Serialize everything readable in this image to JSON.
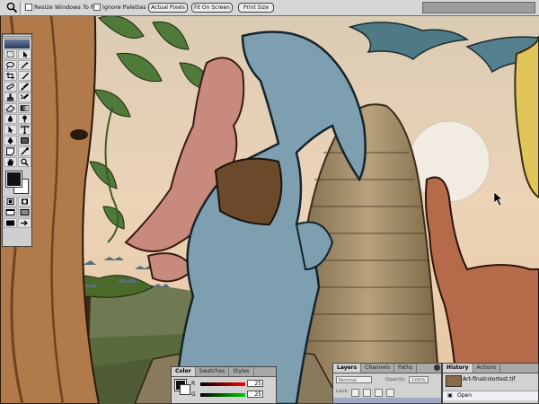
{
  "options_bar": {
    "resize_windows_label": "Resize Windows To Fit",
    "ignore_palettes_label": "Ignore Palettes",
    "actual_pixels_label": "Actual Pixels",
    "fit_on_screen_label": "Fit On Screen",
    "print_size_label": "Print Size"
  },
  "color_palette": {
    "tabs": [
      "Color",
      "Swatches",
      "Styles"
    ],
    "channels": [
      {
        "label": "R",
        "value": "25"
      },
      {
        "label": "G",
        "value": "25"
      }
    ]
  },
  "layers_palette": {
    "tabs": [
      "Layers",
      "Channels",
      "Paths"
    ],
    "blend_mode": "Normal",
    "opacity_label": "Opacity:",
    "opacity_value": "100%",
    "lock_label": "Lock:"
  },
  "history_palette": {
    "tabs": [
      "History",
      "Actions"
    ],
    "document_name": "Art-finalcolortest.tif",
    "items": [
      "Open"
    ]
  },
  "colors": {
    "sky": "#e9cdb0",
    "creature_blue": "#7d9fb0",
    "creature_pink": "#c98a7e",
    "rock": "#9a8664"
  }
}
